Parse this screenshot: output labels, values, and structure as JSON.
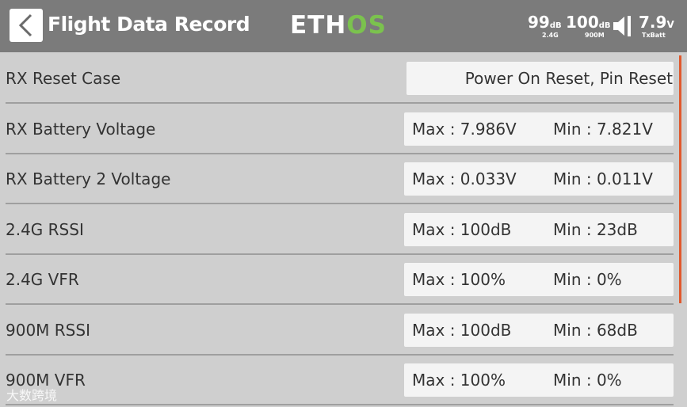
{
  "header": {
    "back_glyph": "<",
    "title": "Flight Data Record",
    "logo_left": "ETH",
    "logo_right": "OS",
    "logo_color_accent": "#7bc24e",
    "rssi_24": {
      "value": "99",
      "unit": "dB",
      "label": "2.4G"
    },
    "rssi_900": {
      "value": "100",
      "unit": "dB",
      "label": "900M"
    },
    "battery": {
      "value": "7.9",
      "unit": "V",
      "label": "TxBatt"
    }
  },
  "rows": [
    {
      "label": "RX Reset Case",
      "value": "Power On Reset, Pin Reset"
    },
    {
      "label": "RX Battery Voltage",
      "max": "Max : 7.986V",
      "min": "Min : 7.821V"
    },
    {
      "label": "RX Battery 2 Voltage",
      "max": "Max : 0.033V",
      "min": "Min : 0.011V"
    },
    {
      "label": "2.4G RSSI",
      "max": "Max : 100dB",
      "min": "Min : 23dB"
    },
    {
      "label": "2.4G VFR",
      "max": "Max : 100%",
      "min": "Min : 0%"
    },
    {
      "label": "900M RSSI",
      "max": "Max : 100dB",
      "min": "Min : 68dB"
    },
    {
      "label": "900M VFR",
      "max": "Max : 100%",
      "min": "Min : 0%"
    }
  ],
  "watermark": "大数跨境",
  "colors": {
    "header_bg": "#7b7b7b",
    "page_bg": "#cfcfcf",
    "scrollbar": "#e0582c"
  }
}
